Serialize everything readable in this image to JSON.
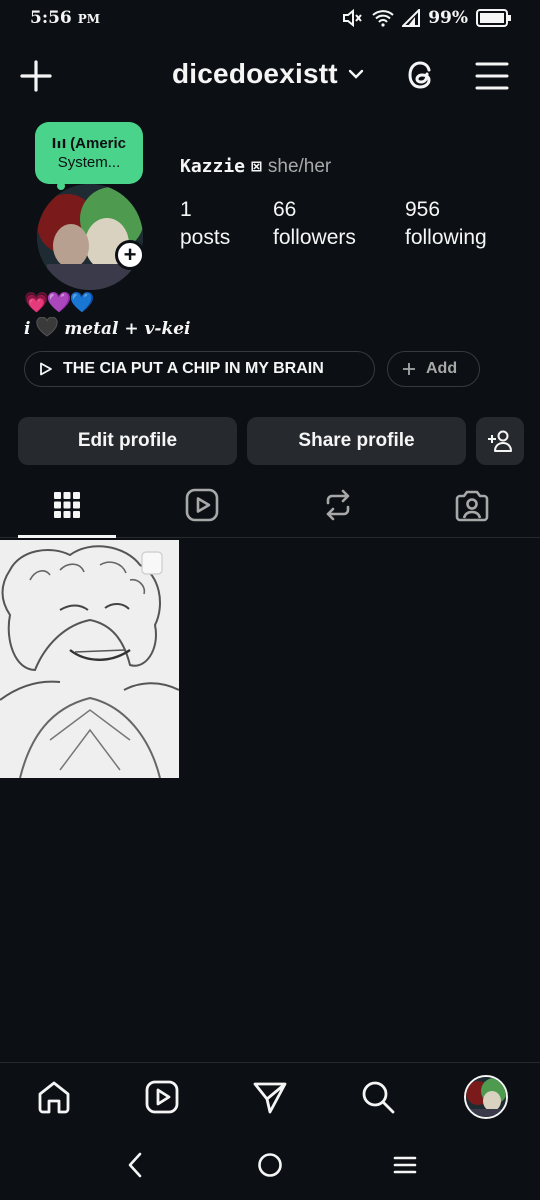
{
  "status_bar": {
    "time": "5:56",
    "ampm": "PM",
    "battery": "99%",
    "icons": [
      "mute-icon",
      "wifi-icon",
      "signal-icon",
      "battery-icon"
    ]
  },
  "header": {
    "username": "dicedoexistt",
    "icons": [
      "plus-icon",
      "chevron-down-icon",
      "threads-icon",
      "menu-icon"
    ]
  },
  "profile": {
    "note": {
      "line1": "(Americ",
      "line2": "System..."
    },
    "name": "Kazzie",
    "name_symbol": "⊠",
    "pronouns": "she/her",
    "stats": [
      {
        "value": "1",
        "label": "posts"
      },
      {
        "value": "66",
        "label": "followers"
      },
      {
        "value": "956",
        "label": "following"
      }
    ],
    "bio_hearts": "💗💜💙",
    "bio_prefix": "i",
    "bio_suffix": "metal + v-kei",
    "music_chip": "THE CIA PUT A CHIP IN MY BRAIN",
    "add_chip": "Add"
  },
  "actions": {
    "edit": "Edit profile",
    "share": "Share profile"
  },
  "tabs": [
    "grid",
    "reels",
    "reposts",
    "tagged"
  ],
  "active_tab": "grid",
  "bottom_nav": [
    "home",
    "reels",
    "direct",
    "search",
    "profile"
  ],
  "colors": {
    "background": "#0c1014",
    "button": "#262a2f",
    "note": "#4ad38a",
    "muted": "#a8a8a8"
  }
}
